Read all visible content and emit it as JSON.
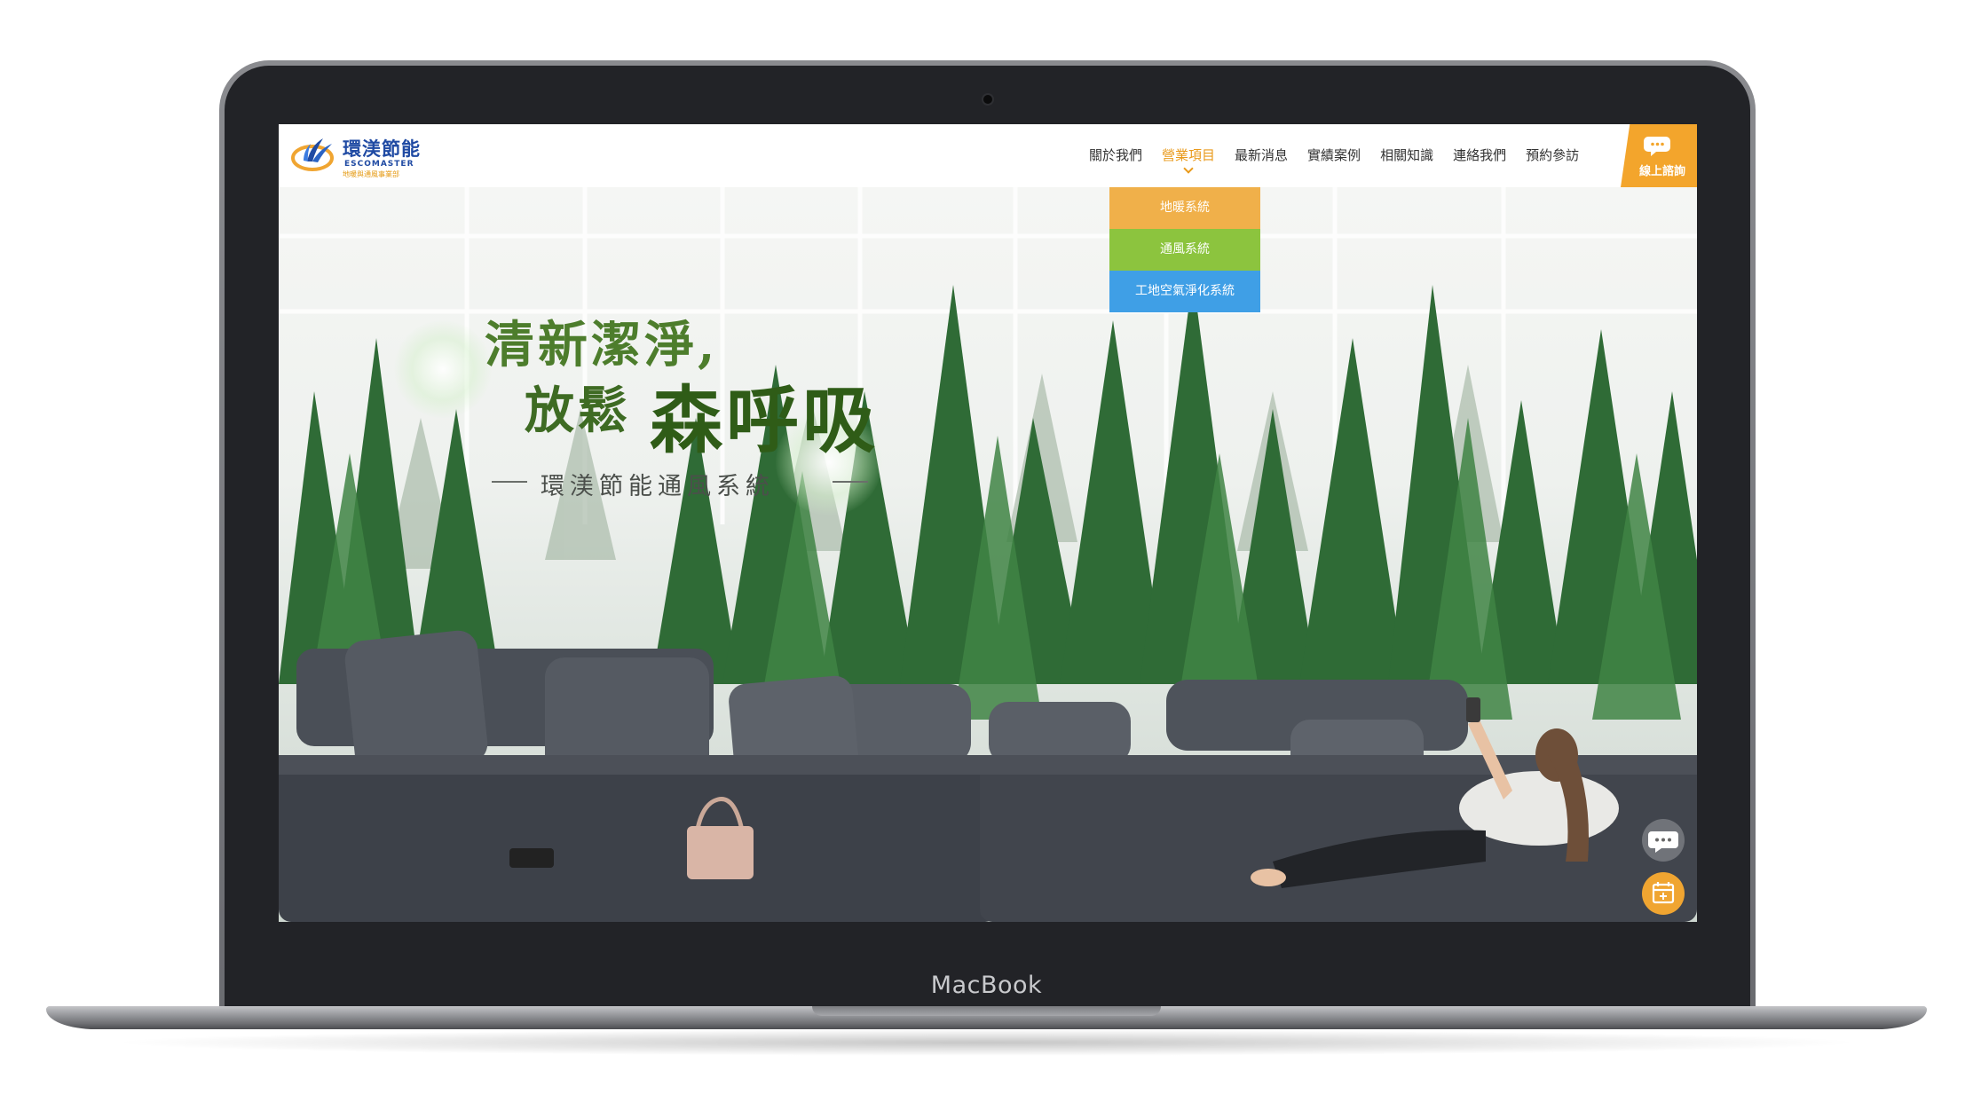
{
  "device": {
    "label": "MacBook"
  },
  "header": {
    "logo": {
      "name_cn": "環渼節能",
      "name_en": "ESCOMASTER",
      "subtitle": "地暖與通風事業部"
    },
    "nav": [
      {
        "label": "關於我們"
      },
      {
        "label": "營業項目"
      },
      {
        "label": "最新消息"
      },
      {
        "label": "實績案例"
      },
      {
        "label": "相關知識"
      },
      {
        "label": "連絡我們"
      },
      {
        "label": "預約參訪"
      }
    ],
    "active_nav": "營業項目",
    "consult_button": {
      "label": "線上諮詢",
      "icon": "chat-icon",
      "color": "#f3a52c"
    }
  },
  "dropdown": {
    "items": [
      {
        "label": "地暖系統",
        "color": "#f0b04a"
      },
      {
        "label": "通風系統",
        "color": "#8cc43e"
      },
      {
        "label": "工地空氣淨化系統",
        "color": "#3f9fe6"
      }
    ]
  },
  "hero": {
    "line1": "清新潔淨,",
    "line2_small": "放鬆",
    "line2_large": "森呼吸",
    "subtitle": "環渼節能通風系統"
  },
  "floating_buttons": [
    {
      "icon": "chat-bubble-icon"
    },
    {
      "icon": "calendar-icon",
      "color": "#f0a531"
    }
  ]
}
